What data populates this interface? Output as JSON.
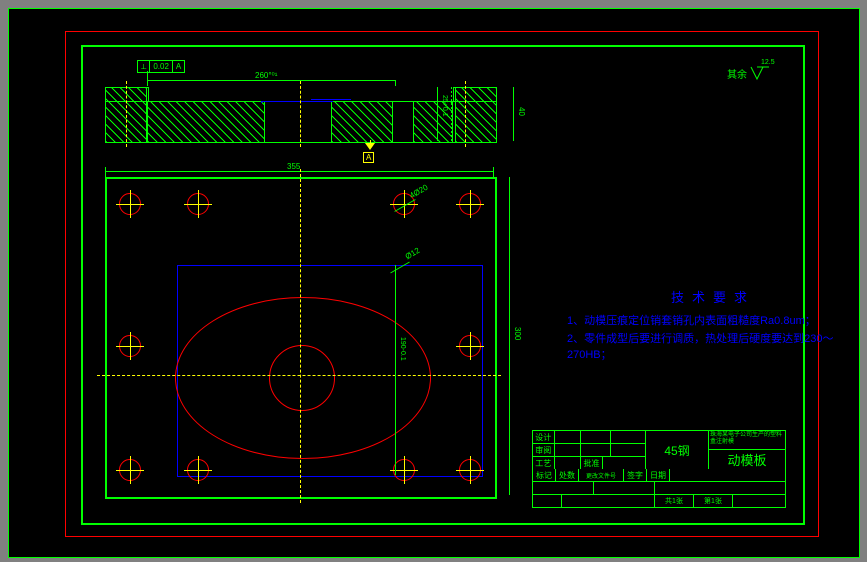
{
  "gtol": {
    "symbol": "⟂",
    "value": "0.02",
    "datum": "A"
  },
  "section": {
    "dim_top": "260°⁰¹",
    "dim_right_h": "40",
    "datum_label": "A"
  },
  "plan": {
    "dim_top_width": "355",
    "dim_right_height": "300",
    "dim_inner_height": "190-0.1",
    "hole_leader_1": "4Ø20",
    "hole_leader_2": "Ø12"
  },
  "surface_finish": {
    "label": "其余",
    "value": "12.5"
  },
  "tech_requirements": {
    "title": "技术要求",
    "lines": [
      "1、动模压痕定位销套销孔内表面粗糙度Ra0.8um；",
      "2、零件成型后要进行调质，热处理后硬度要达到230～270HB；"
    ]
  },
  "title_block": {
    "rows_top": [
      [
        "设计",
        "",
        "",
        "",
        "",
        ""
      ],
      [
        "审阅",
        "",
        "",
        "",
        "",
        ""
      ],
      [
        "工艺",
        "",
        "批准",
        "",
        "",
        ""
      ]
    ],
    "material_label": "45钢",
    "product_label": "珠海某电子公司生产的塑料盒注射模",
    "part_label": "动模板",
    "scale_row": [
      "标记",
      "处数",
      "更改文件号",
      "签字",
      "日期"
    ],
    "bottom_left": "共1张",
    "bottom_mid": "第1张"
  }
}
